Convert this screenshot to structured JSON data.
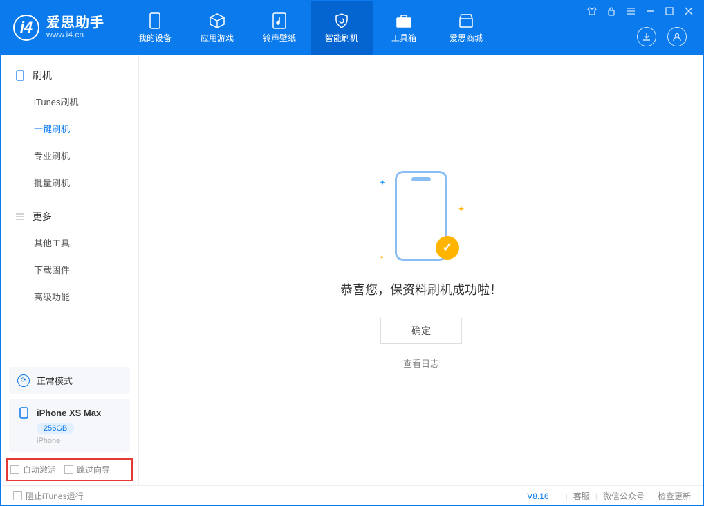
{
  "logo": {
    "title": "爱思助手",
    "subtitle": "www.i4.cn",
    "glyph": "i4"
  },
  "nav": {
    "items": [
      {
        "label": "我的设备"
      },
      {
        "label": "应用游戏"
      },
      {
        "label": "铃声壁纸"
      },
      {
        "label": "智能刷机"
      },
      {
        "label": "工具箱"
      },
      {
        "label": "爱思商城"
      }
    ],
    "active_index": 3
  },
  "sidebar": {
    "groups": [
      {
        "header": "刷机",
        "items": [
          {
            "label": "iTunes刷机"
          },
          {
            "label": "一键刷机"
          },
          {
            "label": "专业刷机"
          },
          {
            "label": "批量刷机"
          }
        ],
        "active_index": 1
      },
      {
        "header": "更多",
        "items": [
          {
            "label": "其他工具"
          },
          {
            "label": "下载固件"
          },
          {
            "label": "高级功能"
          }
        ]
      }
    ],
    "status": {
      "label": "正常模式"
    },
    "device": {
      "name": "iPhone XS Max",
      "storage": "256GB",
      "type": "iPhone"
    },
    "checks": {
      "auto_activate": "自动激活",
      "skip_guide": "跳过向导"
    }
  },
  "main": {
    "success_text": "恭喜您，保资料刷机成功啦！",
    "ok_button": "确定",
    "log_link": "查看日志"
  },
  "footer": {
    "block_itunes": "阻止iTunes运行",
    "version": "V8.16",
    "links": {
      "service": "客服",
      "wechat": "微信公众号",
      "update": "检查更新"
    }
  }
}
